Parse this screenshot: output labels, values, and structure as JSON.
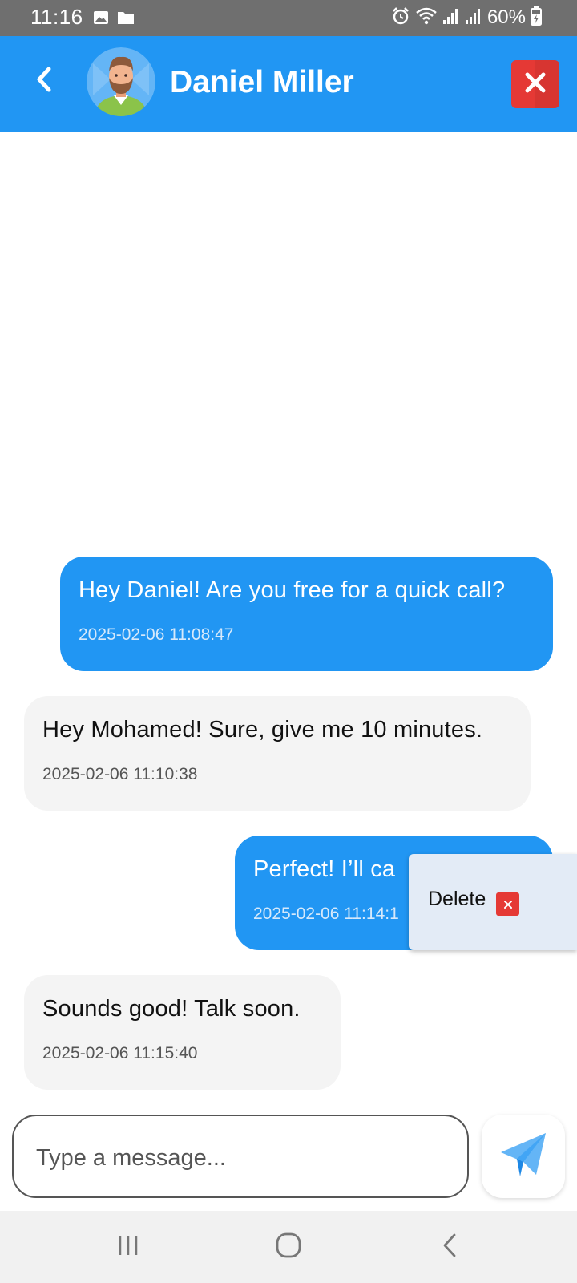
{
  "status_bar": {
    "time": "11:16",
    "battery_text": "60%",
    "icons": [
      "image-icon",
      "folder-icon",
      "alarm-icon",
      "wifi-icon",
      "signal-icon",
      "signal-icon",
      "battery-icon"
    ]
  },
  "header": {
    "contact_name": "Daniel Miller",
    "back_icon": "chevron-left-icon",
    "close_icon": "close-icon"
  },
  "messages": [
    {
      "direction": "sent",
      "text": "Hey Daniel! Are you free for a quick call?",
      "timestamp": "2025-02-06 11:08:47"
    },
    {
      "direction": "received",
      "text": "Hey Mohamed! Sure, give me 10 minutes.",
      "timestamp": "2025-02-06 11:10:38"
    },
    {
      "direction": "sent",
      "text": "Perfect! I’ll ca",
      "timestamp": "2025-02-06 11:14:1"
    },
    {
      "direction": "received",
      "text": "Sounds good! Talk soon.",
      "timestamp": "2025-02-06 11:15:40"
    }
  ],
  "popup_menu": {
    "delete_label": "Delete"
  },
  "composer": {
    "placeholder": "Type a message...",
    "value": ""
  },
  "nav_bar": {
    "icons": [
      "recent-apps-icon",
      "home-icon",
      "back-icon"
    ]
  },
  "colors": {
    "primary": "#2196f3",
    "danger": "#e53935",
    "received_bubble": "#f4f4f4",
    "status_bar": "#6f6f6f"
  }
}
